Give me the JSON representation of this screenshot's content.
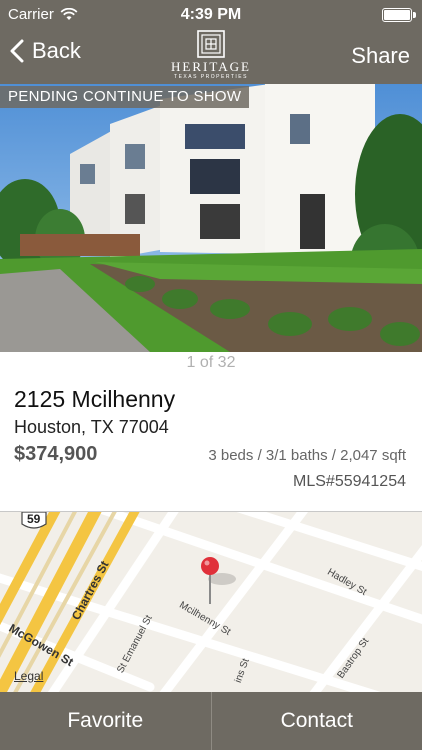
{
  "status_bar": {
    "carrier": "Carrier",
    "time": "4:39 PM",
    "battery_level": 1.0
  },
  "nav": {
    "back_label": "Back",
    "share_label": "Share",
    "logo_name": "HERITAGE",
    "logo_sub": "TEXAS PROPERTIES"
  },
  "photo": {
    "badge": "PENDING CONTINUE TO SHOW",
    "counter": "1 of 32"
  },
  "listing": {
    "address": "2125 Mcilhenny",
    "city_state_zip": "Houston, TX 77004",
    "price": "$374,900",
    "specs": "3 beds / 3/1 baths / 2,047 sqft",
    "mls": "MLS#55941254"
  },
  "map": {
    "highway_shield": "59",
    "streets": {
      "chartres": "Chartres St",
      "mcgowen": "McGowen St",
      "st_emanuel": "St Emanuel St",
      "mcilhenny": "Mcilhenny St",
      "hadley": "Hadley St",
      "bastrop": "Bastrop St",
      "partial": "ins St"
    },
    "legal": "Legal"
  },
  "actions": {
    "favorite": "Favorite",
    "contact": "Contact"
  },
  "colors": {
    "bar": "#6e6a62",
    "freeway": "#f4c542",
    "pin": "#e0303a"
  }
}
